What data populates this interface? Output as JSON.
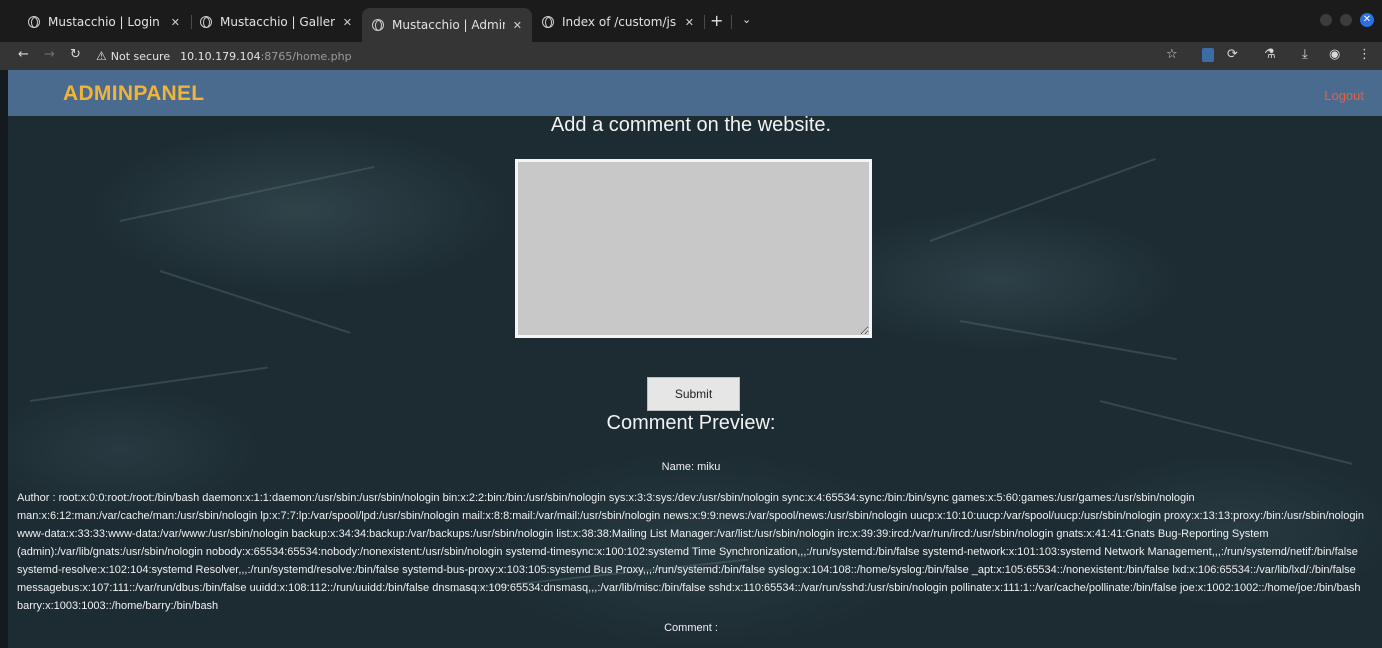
{
  "browser": {
    "tabs": [
      {
        "label": "Mustacchio | Login",
        "active": false
      },
      {
        "label": "Mustacchio | Gallery",
        "active": false
      },
      {
        "label": "Mustacchio | Admin Page",
        "active": true
      },
      {
        "label": "Index of /custom/js",
        "active": false
      }
    ],
    "new_tab": "+",
    "tab_list": "⌄",
    "security_label": "Not secure",
    "url_host": "10.10.179.104",
    "url_path": ":8765/home.php"
  },
  "navbar": {
    "brand": "ADMINPANEL",
    "logout": "Logout"
  },
  "form": {
    "heading": "Add a comment on the website.",
    "textarea_value": "",
    "submit_label": "Submit"
  },
  "preview": {
    "heading": "Comment Preview:",
    "name_line": "Name: miku",
    "author_line": "Author : root:x:0:0:root:/root:/bin/bash daemon:x:1:1:daemon:/usr/sbin:/usr/sbin/nologin bin:x:2:2:bin:/bin:/usr/sbin/nologin sys:x:3:3:sys:/dev:/usr/sbin/nologin sync:x:4:65534:sync:/bin:/bin/sync games:x:5:60:games:/usr/games:/usr/sbin/nologin man:x:6:12:man:/var/cache/man:/usr/sbin/nologin lp:x:7:7:lp:/var/spool/lpd:/usr/sbin/nologin mail:x:8:8:mail:/var/mail:/usr/sbin/nologin news:x:9:9:news:/var/spool/news:/usr/sbin/nologin uucp:x:10:10:uucp:/var/spool/uucp:/usr/sbin/nologin proxy:x:13:13:proxy:/bin:/usr/sbin/nologin www-data:x:33:33:www-data:/var/www:/usr/sbin/nologin backup:x:34:34:backup:/var/backups:/usr/sbin/nologin list:x:38:38:Mailing List Manager:/var/list:/usr/sbin/nologin irc:x:39:39:ircd:/var/run/ircd:/usr/sbin/nologin gnats:x:41:41:Gnats Bug-Reporting System (admin):/var/lib/gnats:/usr/sbin/nologin nobody:x:65534:65534:nobody:/nonexistent:/usr/sbin/nologin systemd-timesync:x:100:102:systemd Time Synchronization,,,:/run/systemd:/bin/false systemd-network:x:101:103:systemd Network Management,,,:/run/systemd/netif:/bin/false systemd-resolve:x:102:104:systemd Resolver,,,:/run/systemd/resolve:/bin/false systemd-bus-proxy:x:103:105:systemd Bus Proxy,,,:/run/systemd:/bin/false syslog:x:104:108::/home/syslog:/bin/false _apt:x:105:65534::/nonexistent:/bin/false lxd:x:106:65534::/var/lib/lxd/:/bin/false messagebus:x:107:111::/var/run/dbus:/bin/false uuidd:x:108:112::/run/uuidd:/bin/false dnsmasq:x:109:65534:dnsmasq,,,:/var/lib/misc:/bin/false sshd:x:110:65534::/var/run/sshd:/usr/sbin/nologin pollinate:x:111:1::/var/cache/pollinate:/bin/false joe:x:1002:1002::/home/joe:/bin/bash barry:x:1003:1003::/home/barry:/bin/bash",
    "comment_line": "Comment :"
  },
  "colors": {
    "navbar_bg": "#4a6a8e",
    "brand": "#f0b43a",
    "logout": "#e8603c",
    "page_bg": "#1d2c33",
    "textarea_bg": "#c8c8c8"
  },
  "icons": [
    "globe-icon",
    "close-icon",
    "back-icon",
    "forward-icon",
    "reload-icon",
    "warning-icon",
    "star-icon",
    "extension-icon",
    "puzzle-icon",
    "labs-icon",
    "download-icon",
    "profile-icon",
    "menu-icon"
  ]
}
